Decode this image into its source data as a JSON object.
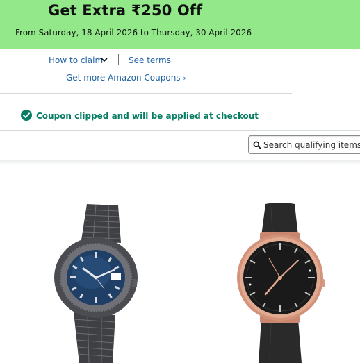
{
  "banner": {
    "title": "Get Extra ₹250 Off",
    "dates": "From Saturday, 18 April 2026 to Thursday, 30 April 2026",
    "background": "#93e98a"
  },
  "claim": {
    "how_to_claim_label": "How to claim",
    "how_to_claim_icon": "chevron-down-icon",
    "see_terms_label": "See terms",
    "more_coupons_label": "Get more Amazon Coupons",
    "more_coupons_icon": "chevron-right-icon",
    "more_coupons_chevron": "›",
    "link_color": "#2162a1"
  },
  "status": {
    "icon": "check-circle-icon",
    "message": "Coupon clipped and will be applied at checkout",
    "color": "#067d62"
  },
  "search": {
    "icon": "search-icon",
    "placeholder": "Search qualifying items",
    "value": ""
  },
  "products": [
    {
      "name": "gunmetal bracelet watch with blue dial",
      "strap_color": "#4a4a4e",
      "dial_color": "#1f3f66"
    },
    {
      "name": "black leather strap watch with rose gold case",
      "strap_color": "#2a2a2a",
      "dial_color": "#1a1a1a"
    }
  ]
}
